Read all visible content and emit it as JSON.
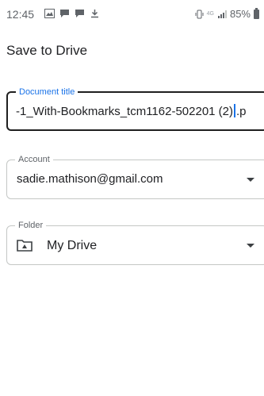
{
  "status_bar": {
    "time": "12:45",
    "left_icons": [
      "photos-icon",
      "chat-icon",
      "chat-icon",
      "download-icon"
    ],
    "network_badge": "4G",
    "battery": "85%"
  },
  "page": {
    "title": "Save to Drive"
  },
  "document_title": {
    "label": "Document title",
    "value_before_cursor": "-1_With-Bookmarks_tcm1162-502201 (2)",
    "value_after_cursor": ".p",
    "focused": true,
    "accent_color": "#1a73e8"
  },
  "account": {
    "label": "Account",
    "value": "sadie.mathison@gmail.com",
    "icon": "chevron-down-icon"
  },
  "folder": {
    "label": "Folder",
    "value": "My Drive",
    "icon": "folder-icon",
    "dropdown_icon": "chevron-down-icon"
  }
}
